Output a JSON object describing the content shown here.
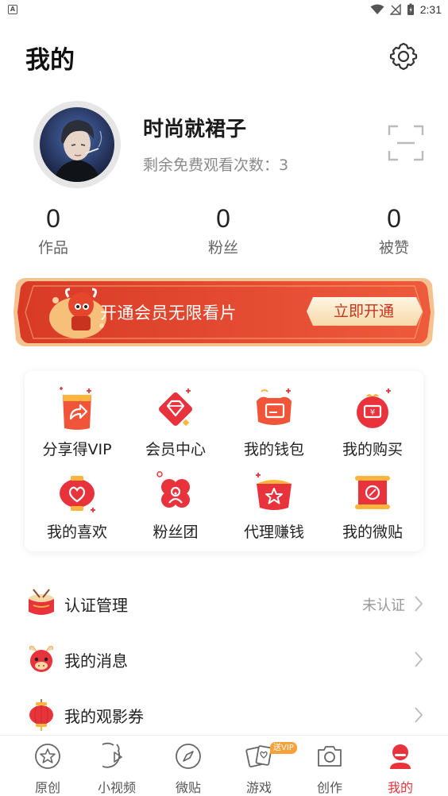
{
  "status_bar": {
    "time": "2:31",
    "app_icon": "A"
  },
  "header": {
    "title": "我的"
  },
  "profile": {
    "name": "时尚就裙子",
    "free_views_label": "剩余免费观看次数：3"
  },
  "stats": [
    {
      "value": "0",
      "label": "作品"
    },
    {
      "value": "0",
      "label": "粉丝"
    },
    {
      "value": "0",
      "label": "被赞"
    }
  ],
  "banner": {
    "text": "开通会员无限看片",
    "button": "立即开通"
  },
  "grid": [
    {
      "label": "分享得VIP",
      "icon": "share-icon"
    },
    {
      "label": "会员中心",
      "icon": "diamond-icon"
    },
    {
      "label": "我的钱包",
      "icon": "wallet-icon"
    },
    {
      "label": "我的购买",
      "icon": "purchase-icon"
    },
    {
      "label": "我的喜欢",
      "icon": "heart-lantern-icon"
    },
    {
      "label": "粉丝团",
      "icon": "fans-icon"
    },
    {
      "label": "代理赚钱",
      "icon": "agent-icon"
    },
    {
      "label": "我的微贴",
      "icon": "scroll-icon"
    }
  ],
  "list": [
    {
      "label": "认证管理",
      "value": "未认证",
      "icon": "drum-icon"
    },
    {
      "label": "我的消息",
      "value": "",
      "icon": "ox-icon"
    },
    {
      "label": "我的观影券",
      "value": "",
      "icon": "lantern-icon"
    }
  ],
  "bottom_nav": [
    {
      "label": "原创",
      "icon": "star-icon"
    },
    {
      "label": "小视频",
      "icon": "play-icon"
    },
    {
      "label": "微贴",
      "icon": "compass-icon"
    },
    {
      "label": "游戏",
      "icon": "cards-icon"
    },
    {
      "label": "创作",
      "icon": "camera-icon"
    },
    {
      "label": "我的",
      "icon": "profile-icon"
    }
  ],
  "game_badge": "送VIP",
  "colors": {
    "accent": "#e8323c",
    "banner": "#e5452f",
    "muted": "#8a8a8a"
  }
}
